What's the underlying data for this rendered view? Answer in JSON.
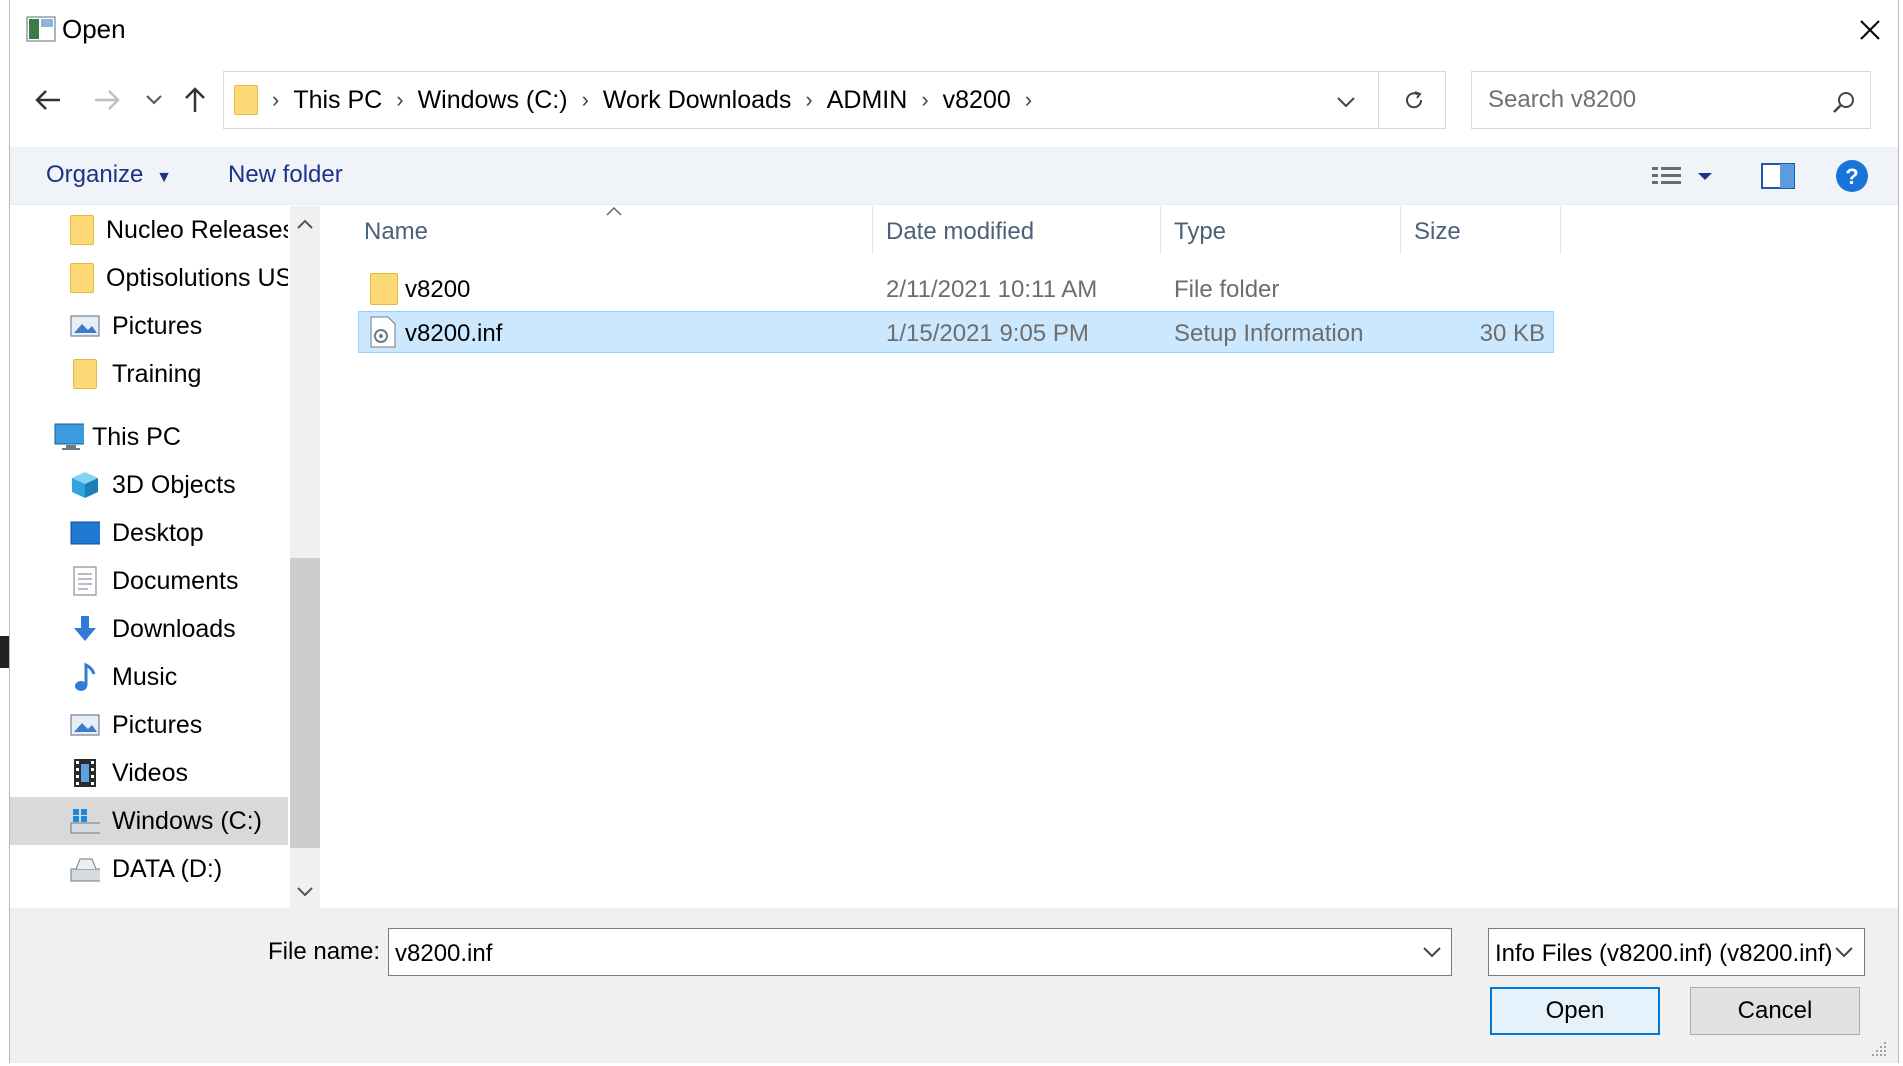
{
  "window": {
    "title": "Open"
  },
  "toolbar": {
    "back_icon": "arrow-left-icon",
    "forward_icon": "arrow-right-icon",
    "recent_icon": "chevron-down-icon",
    "up_icon": "arrow-up-icon"
  },
  "address": {
    "breadcrumbs": [
      "This PC",
      "Windows (C:)",
      "Work Downloads",
      "ADMIN",
      "v8200"
    ]
  },
  "search": {
    "placeholder": "Search v8200"
  },
  "commands": {
    "organize": "Organize",
    "new_folder": "New folder"
  },
  "nav": {
    "items": [
      {
        "label": "Nucleo Releases",
        "icon": "folder-icon"
      },
      {
        "label": "Optisolutions US",
        "icon": "folder-icon"
      },
      {
        "label": "Pictures",
        "icon": "pictures-icon"
      },
      {
        "label": "Training",
        "icon": "folder-icon"
      },
      {
        "label": "This PC",
        "icon": "computer-icon"
      },
      {
        "label": "3D Objects",
        "icon": "cube-icon"
      },
      {
        "label": "Desktop",
        "icon": "desktop-icon"
      },
      {
        "label": "Documents",
        "icon": "documents-icon"
      },
      {
        "label": "Downloads",
        "icon": "download-icon"
      },
      {
        "label": "Music",
        "icon": "music-icon"
      },
      {
        "label": "Pictures",
        "icon": "pictures-icon"
      },
      {
        "label": "Videos",
        "icon": "videos-icon"
      },
      {
        "label": "Windows (C:)",
        "icon": "drive-icon"
      },
      {
        "label": "DATA (D:)",
        "icon": "drive-icon"
      }
    ]
  },
  "files": {
    "columns": {
      "name": "Name",
      "date": "Date modified",
      "type": "Type",
      "size": "Size"
    },
    "rows": [
      {
        "name": "v8200",
        "date": "2/11/2021 10:11 AM",
        "type": "File folder",
        "size": ""
      },
      {
        "name": "v8200.inf",
        "date": "1/15/2021 9:05 PM",
        "type": "Setup Information",
        "size": "30 KB"
      }
    ]
  },
  "footer": {
    "file_name_label": "File name:",
    "file_name_value": "v8200.inf",
    "file_type_value": "Info Files (v8200.inf) (v8200.inf)",
    "open_label": "Open",
    "cancel_label": "Cancel"
  }
}
